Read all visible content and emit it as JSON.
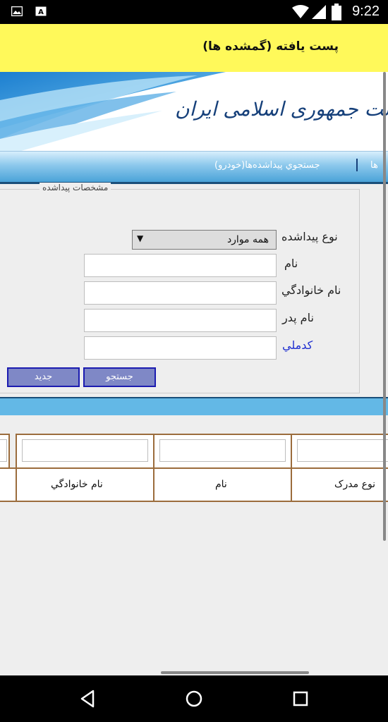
{
  "status_bar": {
    "time": "9:22",
    "icons": [
      "image-icon",
      "font-a-icon",
      "wifi-icon",
      "signal-icon",
      "battery-icon"
    ]
  },
  "app_bar": {
    "title": "پست یافته (گمشده ها)",
    "background": "#fff95a"
  },
  "banner": {
    "text": "ملی پست جمهوری اسلامی ایران"
  },
  "nav": {
    "link_partial": "ها",
    "link_vehicles": "جستجوي پيداشده‌ها(خودرو)"
  },
  "form": {
    "legend": "مشخصات پيداشده",
    "found_type_label": "نوع پيداشده",
    "found_type_value": "همه موارد",
    "name_label": "نام",
    "family_label": "نام خانوادگي",
    "father_label": "نام پدر",
    "national_code_label": "کدملي",
    "search_button": "جستجو",
    "new_button": "جديد"
  },
  "results": {
    "columns": [
      "نوع مدرک",
      "نام",
      "نام خانوادگي",
      ""
    ]
  },
  "colors": {
    "accent": "#63b8e6",
    "button": "#7f88c6",
    "link": "#1f2fd0",
    "table_border": "#9b6c3c"
  }
}
